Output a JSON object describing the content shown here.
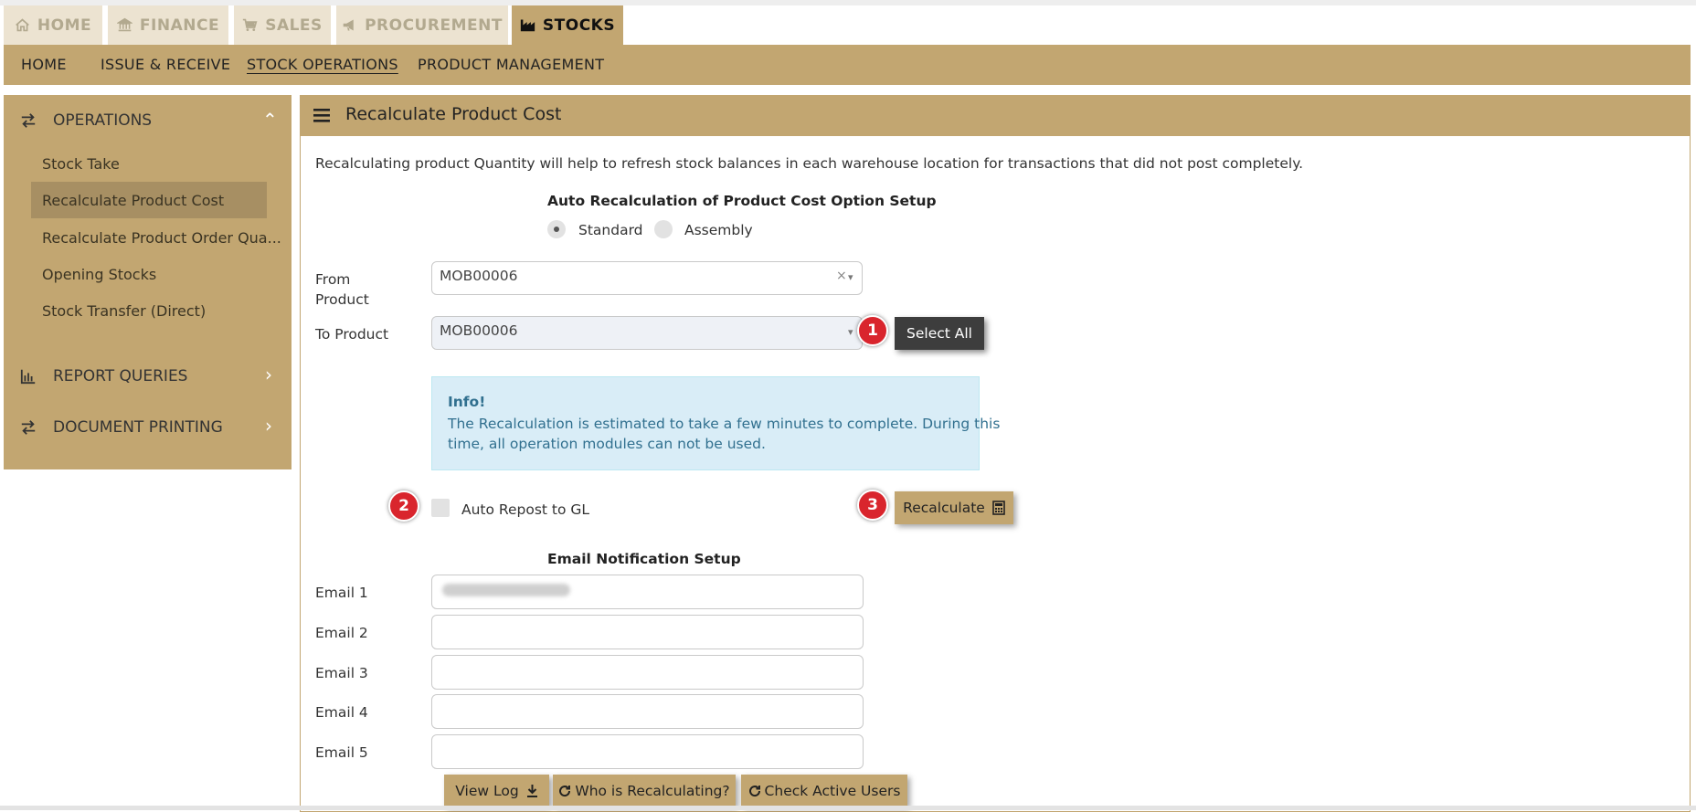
{
  "top_tabs": [
    {
      "label": "HOME",
      "icon": "home-icon"
    },
    {
      "label": "FINANCE",
      "icon": "bank-icon"
    },
    {
      "label": "SALES",
      "icon": "cart-icon"
    },
    {
      "label": "PROCUREMENT",
      "icon": "megaphone-icon"
    },
    {
      "label": "STOCKS",
      "icon": "factory-icon",
      "active": true
    }
  ],
  "sub_nav": [
    {
      "label": "HOME"
    },
    {
      "label": "ISSUE & RECEIVE"
    },
    {
      "label": "STOCK OPERATIONS",
      "active": true
    },
    {
      "label": "PRODUCT MANAGEMENT"
    }
  ],
  "sidebar": {
    "operations_label": "OPERATIONS",
    "items": [
      {
        "label": "Stock Take"
      },
      {
        "label": "Recalculate Product Cost",
        "active": true
      },
      {
        "label": "Recalculate Product Order Qua..."
      },
      {
        "label": "Opening Stocks"
      },
      {
        "label": "Stock Transfer (Direct)"
      }
    ],
    "report_queries_label": "REPORT QUERIES",
    "document_printing_label": "DOCUMENT PRINTING"
  },
  "panel": {
    "title": "Recalculate Product Cost",
    "description": "Recalculating product Quantity will help to refresh stock balances in each warehouse location for transactions that did not post completely.",
    "option_setup_title": "Auto Recalculation of Product Cost Option Setup",
    "radio_standard": "Standard",
    "radio_assembly": "Assembly",
    "selected_option": "Standard",
    "from_product_label_1": "From",
    "from_product_label_2": "Product",
    "from_product_value": "MOB00006",
    "to_product_label": "To Product",
    "to_product_value": "MOB00006",
    "select_all_label": "Select All",
    "info_title": "Info!",
    "info_line1": "The Recalculation is estimated to take a few minutes to complete. During this",
    "info_line2": "time, all operation modules can not be used.",
    "auto_repost_label": "Auto Repost to GL",
    "recalculate_label": "Recalculate",
    "email_setup_title": "Email Notification Setup",
    "email_labels": [
      "Email 1",
      "Email 2",
      "Email 3",
      "Email 4",
      "Email 5"
    ],
    "view_log_label": "View Log",
    "who_recalc_label": "Who is Recalculating?",
    "check_users_label": "Check Active Users"
  },
  "badges": [
    "1",
    "2",
    "3"
  ],
  "colors": {
    "accent": "#c2a671",
    "sidebar_active": "#a78f63",
    "tab_inactive": "#ece3d1",
    "info_bg": "#d9edf7",
    "info_title": "#31708f",
    "badge": "#d9252d",
    "dark_button": "#3d3d3d"
  }
}
